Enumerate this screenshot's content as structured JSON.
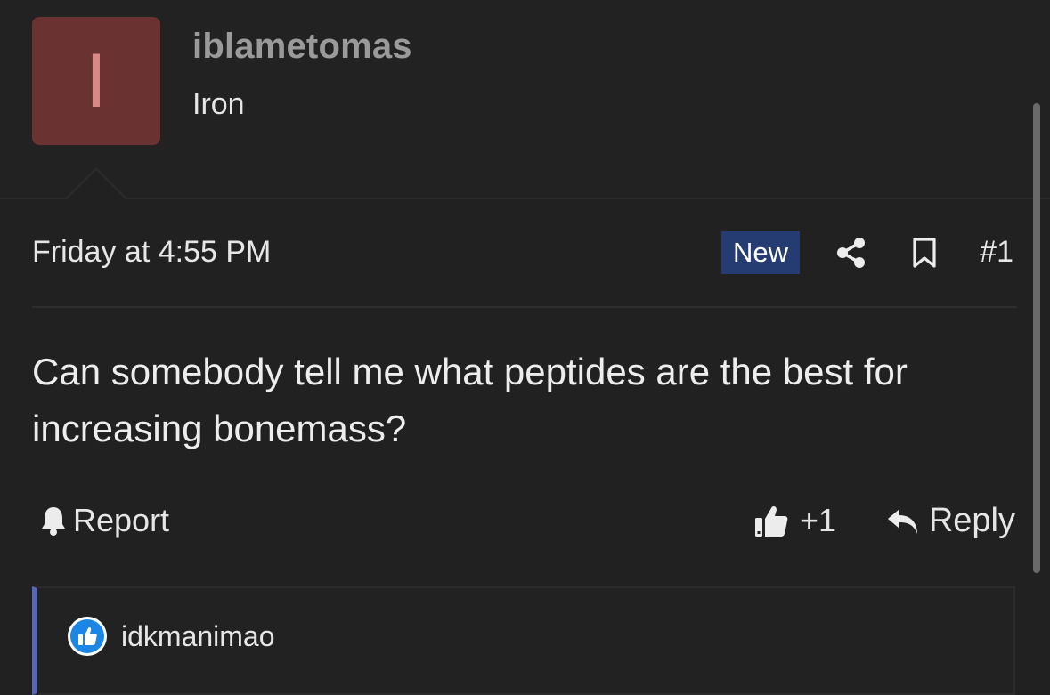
{
  "user": {
    "avatar_letter": "I",
    "username": "iblametomas",
    "title": "Iron"
  },
  "post": {
    "date": "Friday at 4:55 PM",
    "badge": "New",
    "number": "#1",
    "body_lines": [
      "Can somebody tell me what peptides are the best for",
      "increasing bonemass?"
    ]
  },
  "actions": {
    "report_label": "Report",
    "like_label": "+1",
    "reply_label": "Reply"
  },
  "reactions": {
    "user": "idkmanimao"
  },
  "icons": {
    "share": "share-icon",
    "bookmark": "bookmark-icon",
    "report": "bell-icon",
    "like": "thumbs-up-icon",
    "reply": "reply-arrow-icon"
  },
  "colors": {
    "background": "#212121",
    "avatar_bg": "#6a3231",
    "badge_bg": "#243c72",
    "reaction_accent": "#5a66b8",
    "reaction_blue": "#1b86e6"
  }
}
